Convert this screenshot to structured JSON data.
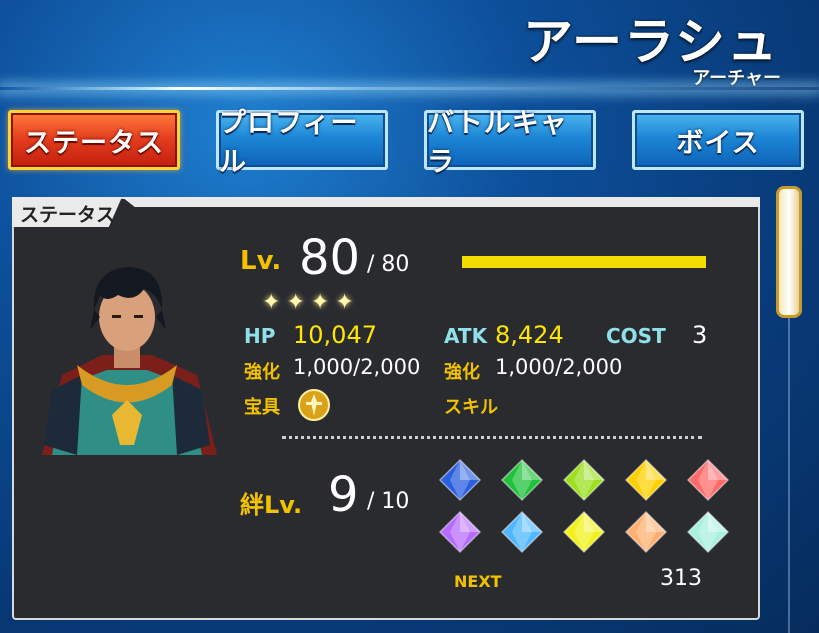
{
  "header": {
    "character_name": "アーラシュ",
    "character_class": "アーチャー"
  },
  "tabs": [
    {
      "label": "ステータス",
      "active": true
    },
    {
      "label": "プロフィール",
      "active": false
    },
    {
      "label": "バトルキャラ",
      "active": false
    },
    {
      "label": "ボイス",
      "active": false
    }
  ],
  "status_panel": {
    "title": "ステータス",
    "level_label": "Lv.",
    "level": "80",
    "level_max": "/ 80",
    "level_progress": 1.0,
    "stars": 4,
    "hp_label": "HP",
    "hp": "10,047",
    "atk_label": "ATK",
    "atk": "8,424",
    "cost_label": "COST",
    "cost": "3",
    "hp_enhance_label": "強化",
    "hp_enhance": "1,000/2,000",
    "atk_enhance_label": "強化",
    "atk_enhance": "1,000/2,000",
    "noble_phantasm_label": "宝具",
    "skill_label": "スキル",
    "bond_label": "絆Lv.",
    "bond_level": "9",
    "bond_max": "/ 10",
    "bond_gems": [
      "#2a5fe0",
      "#1fc23a",
      "#9be021",
      "#ffd000",
      "#ff6b6b",
      "#b86cff",
      "#4fb8ff",
      "#f2f21a",
      "#ffb070",
      "#a8f0e0"
    ],
    "next_label": "NEXT",
    "next_value": "313"
  },
  "colors": {
    "accent_gold": "#f2c200",
    "stat_yellow": "#ffe600",
    "label_cyan": "#8fe0e8",
    "active_tab_red": "#e23b1c",
    "tab_blue": "#1c86d6"
  }
}
